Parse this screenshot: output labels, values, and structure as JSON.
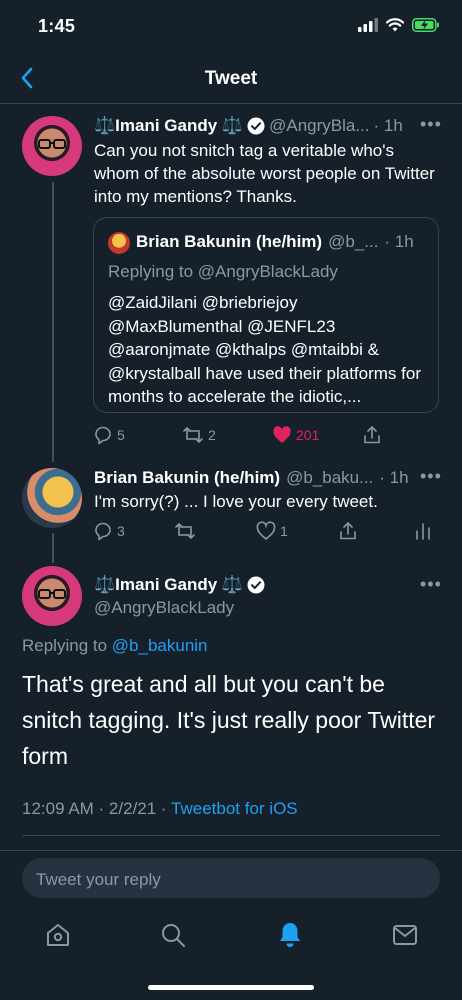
{
  "status_bar": {
    "time": "1:45"
  },
  "nav": {
    "title": "Tweet"
  },
  "tweet1": {
    "name": "⚖️Imani Gandy ⚖️",
    "handle": "@AngryBla...",
    "age": "· 1h",
    "text": "Can you not snitch tag a veritable who's whom of the absolute worst people on Twitter into my mentions? Thanks.",
    "quote": {
      "name": "Brian Bakunin (he/him)",
      "handle": "@b_...",
      "age": "· 1h",
      "replying_prefix": "Replying to",
      "replying_handle": "@AngryBlackLady",
      "text": "@ZaidJilani @briebriejoy @MaxBlumenthal @JENFL23 @aaronjmate @kthalps @mtaibbi & @krystalball have used their platforms for months to accelerate the idiotic,..."
    },
    "replies": "5",
    "retweets": "2",
    "likes": "201"
  },
  "tweet2": {
    "name": "Brian Bakunin (he/him)",
    "handle": "@b_baku...",
    "age": "· 1h",
    "text": "I'm sorry(?) ... I love your every tweet.",
    "replies": "3",
    "likes": "1"
  },
  "main_tweet": {
    "name": "⚖️Imani Gandy ⚖️",
    "handle": "@AngryBlackLady",
    "replying_prefix": "Replying to",
    "replying_handle": "@b_bakunin",
    "text": "That's great and all but you can't be snitch tagging. It's just really poor Twitter form",
    "timestamp": "12:09 AM · 2/2/21 ·",
    "source": "Tweetbot for iOS"
  },
  "reply_box": {
    "placeholder": "Tweet your reply"
  },
  "colors": {
    "background": "#15202b",
    "accent": "#1da1f2",
    "like": "#e0245e",
    "muted": "#8899a6",
    "border": "#38444d"
  },
  "icons": [
    "back-chevron-icon",
    "verified-badge-icon",
    "more-icon",
    "reply-icon",
    "retweet-icon",
    "like-icon",
    "share-icon",
    "stats-icon",
    "home-icon",
    "search-icon",
    "notifications-icon",
    "messages-icon"
  ]
}
